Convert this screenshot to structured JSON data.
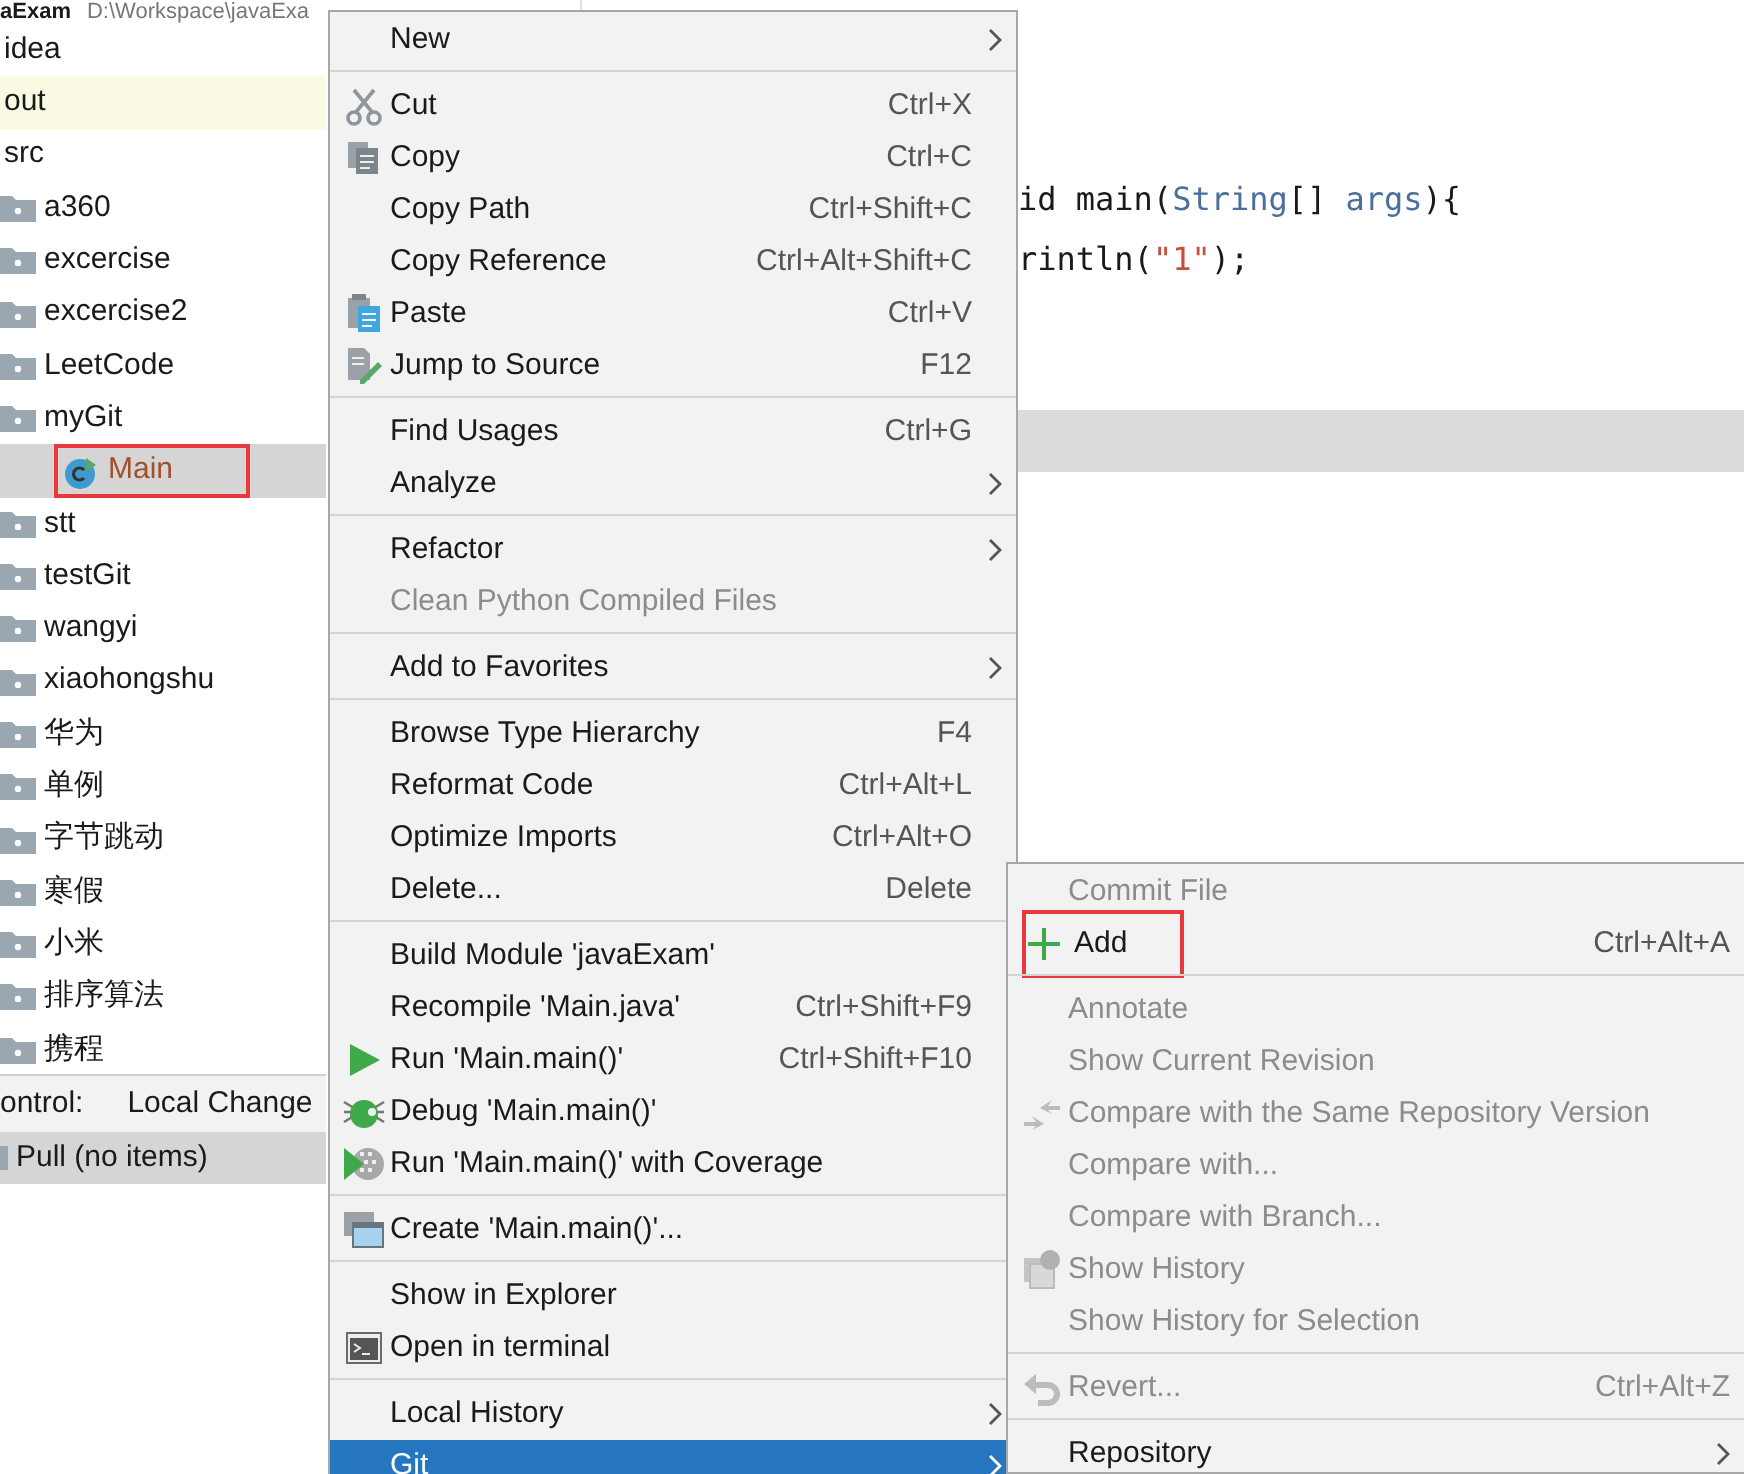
{
  "project_header": {
    "name": "aExam",
    "path": "D:\\Workspace\\javaExa"
  },
  "tree": [
    {
      "label": "idea",
      "excluded": false,
      "selected": false,
      "annotated": false
    },
    {
      "label": "out",
      "excluded": true,
      "selected": false,
      "annotated": false
    },
    {
      "label": "src",
      "excluded": false,
      "selected": false,
      "annotated": false,
      "children": [
        {
          "label": "a360",
          "kind": "package",
          "excluded": false,
          "selected": false,
          "annotated": false
        },
        {
          "label": "excercise",
          "kind": "package",
          "excluded": false,
          "selected": false,
          "annotated": false
        },
        {
          "label": "excercise2",
          "kind": "package",
          "excluded": false,
          "selected": false,
          "annotated": false
        },
        {
          "label": "LeetCode",
          "kind": "package",
          "excluded": false,
          "selected": false,
          "annotated": false
        },
        {
          "label": "myGit",
          "kind": "package",
          "excluded": false,
          "selected": false,
          "annotated": false,
          "children": [
            {
              "label": "Main",
              "kind": "class",
              "excluded": false,
              "selected": true,
              "annotated": true
            }
          ]
        },
        {
          "label": "stt",
          "kind": "package",
          "excluded": false,
          "selected": false,
          "annotated": false
        },
        {
          "label": "testGit",
          "kind": "package",
          "excluded": false,
          "selected": false,
          "annotated": false
        },
        {
          "label": "wangyi",
          "kind": "package",
          "excluded": false,
          "selected": false,
          "annotated": false
        },
        {
          "label": "xiaohongshu",
          "kind": "package",
          "excluded": false,
          "selected": false,
          "annotated": false
        },
        {
          "label": "华为",
          "kind": "package",
          "excluded": false,
          "selected": false,
          "annotated": false
        },
        {
          "label": "单例",
          "kind": "package",
          "excluded": false,
          "selected": false,
          "annotated": false
        },
        {
          "label": "字节跳动",
          "kind": "package",
          "excluded": false,
          "selected": false,
          "annotated": false
        },
        {
          "label": "寒假",
          "kind": "package",
          "excluded": false,
          "selected": false,
          "annotated": false
        },
        {
          "label": "小米",
          "kind": "package",
          "excluded": false,
          "selected": false,
          "annotated": false
        },
        {
          "label": "排序算法",
          "kind": "package",
          "excluded": false,
          "selected": false,
          "annotated": false
        },
        {
          "label": "携程",
          "kind": "package",
          "excluded": false,
          "selected": false,
          "annotated": false
        }
      ]
    }
  ],
  "version_control": {
    "title": "ontrol:",
    "tab": "Local Change",
    "row": "Pull (no items)"
  },
  "editor": {
    "lines": [
      {
        "kind": "top"
      },
      {
        "kind": "blank"
      },
      {
        "kind": "blank"
      },
      {
        "kind": "code",
        "parts": [
          {
            "text": "id main(",
            "kind": "plain"
          },
          {
            "text": "String",
            "kind": "type"
          },
          {
            "text": "[] ",
            "kind": "plain"
          },
          {
            "text": "args",
            "kind": "param"
          },
          {
            "text": "){",
            "kind": "plain"
          }
        ]
      },
      {
        "kind": "code",
        "parts": [
          {
            "text": "rintln(",
            "kind": "plain"
          },
          {
            "text": "\"1\"",
            "kind": "string"
          },
          {
            "text": ");",
            "kind": "plain"
          }
        ]
      },
      {
        "kind": "blank"
      },
      {
        "kind": "blank"
      },
      {
        "kind": "current"
      }
    ]
  },
  "context_menu": [
    {
      "kind": "item",
      "label": "New",
      "submenu": true,
      "disabled": false,
      "selected": false
    },
    {
      "kind": "separator"
    },
    {
      "kind": "item",
      "label": "Cut",
      "shortcut": "Ctrl+X",
      "submenu": false,
      "disabled": false,
      "selected": false
    },
    {
      "kind": "item",
      "label": "Copy",
      "shortcut": "Ctrl+C",
      "submenu": false,
      "disabled": false,
      "selected": false
    },
    {
      "kind": "item",
      "label": "Copy Path",
      "shortcut": "Ctrl+Shift+C",
      "submenu": false,
      "disabled": false,
      "selected": false
    },
    {
      "kind": "item",
      "label": "Copy Reference",
      "shortcut": "Ctrl+Alt+Shift+C",
      "submenu": false,
      "disabled": false,
      "selected": false
    },
    {
      "kind": "item",
      "label": "Paste",
      "shortcut": "Ctrl+V",
      "submenu": false,
      "disabled": false,
      "selected": false
    },
    {
      "kind": "item",
      "label": "Jump to Source",
      "shortcut": "F12",
      "submenu": false,
      "disabled": false,
      "selected": false
    },
    {
      "kind": "separator"
    },
    {
      "kind": "item",
      "label": "Find Usages",
      "shortcut": "Ctrl+G",
      "submenu": false,
      "disabled": false,
      "selected": false
    },
    {
      "kind": "item",
      "label": "Analyze",
      "submenu": true,
      "disabled": false,
      "selected": false
    },
    {
      "kind": "separator"
    },
    {
      "kind": "item",
      "label": "Refactor",
      "submenu": true,
      "disabled": false,
      "selected": false
    },
    {
      "kind": "item",
      "label": "Clean Python Compiled Files",
      "submenu": false,
      "disabled": true,
      "selected": false
    },
    {
      "kind": "separator"
    },
    {
      "kind": "item",
      "label": "Add to Favorites",
      "submenu": true,
      "disabled": false,
      "selected": false
    },
    {
      "kind": "separator"
    },
    {
      "kind": "item",
      "label": "Browse Type Hierarchy",
      "shortcut": "F4",
      "submenu": false,
      "disabled": false,
      "selected": false
    },
    {
      "kind": "item",
      "label": "Reformat Code",
      "shortcut": "Ctrl+Alt+L",
      "submenu": false,
      "disabled": false,
      "selected": false
    },
    {
      "kind": "item",
      "label": "Optimize Imports",
      "shortcut": "Ctrl+Alt+O",
      "submenu": false,
      "disabled": false,
      "selected": false
    },
    {
      "kind": "item",
      "label": "Delete...",
      "shortcut": "Delete",
      "submenu": false,
      "disabled": false,
      "selected": false
    },
    {
      "kind": "separator"
    },
    {
      "kind": "item",
      "label": "Build Module 'javaExam'",
      "submenu": false,
      "disabled": false,
      "selected": false
    },
    {
      "kind": "item",
      "label": "Recompile 'Main.java'",
      "shortcut": "Ctrl+Shift+F9",
      "submenu": false,
      "disabled": false,
      "selected": false
    },
    {
      "kind": "item",
      "label": "Run 'Main.main()'",
      "shortcut": "Ctrl+Shift+F10",
      "submenu": false,
      "disabled": false,
      "selected": false
    },
    {
      "kind": "item",
      "label": "Debug 'Main.main()'",
      "submenu": false,
      "disabled": false,
      "selected": false
    },
    {
      "kind": "item",
      "label": "Run 'Main.main()' with Coverage",
      "submenu": false,
      "disabled": false,
      "selected": false
    },
    {
      "kind": "separator"
    },
    {
      "kind": "item",
      "label": "Create 'Main.main()'...",
      "submenu": false,
      "disabled": false,
      "selected": false
    },
    {
      "kind": "separator"
    },
    {
      "kind": "item",
      "label": "Show in Explorer",
      "submenu": false,
      "disabled": false,
      "selected": false
    },
    {
      "kind": "item",
      "label": "Open in terminal",
      "submenu": false,
      "disabled": false,
      "selected": false
    },
    {
      "kind": "separator"
    },
    {
      "kind": "item",
      "label": "Local History",
      "submenu": true,
      "disabled": false,
      "selected": false
    },
    {
      "kind": "item",
      "label": "Git",
      "submenu": true,
      "disabled": false,
      "selected": true
    }
  ],
  "git_submenu": [
    {
      "kind": "item",
      "label": "Commit File",
      "submenu": false,
      "disabled": true,
      "annotated": false
    },
    {
      "kind": "item",
      "label": "Add",
      "shortcut": "Ctrl+Alt+A",
      "submenu": false,
      "disabled": false,
      "annotated": true
    },
    {
      "kind": "separator"
    },
    {
      "kind": "item",
      "label": "Annotate",
      "submenu": false,
      "disabled": true,
      "annotated": false
    },
    {
      "kind": "item",
      "label": "Show Current Revision",
      "submenu": false,
      "disabled": true,
      "annotated": false
    },
    {
      "kind": "item",
      "label": "Compare with the Same Repository Version",
      "submenu": false,
      "disabled": true,
      "annotated": false
    },
    {
      "kind": "item",
      "label": "Compare with...",
      "submenu": false,
      "disabled": true,
      "annotated": false
    },
    {
      "kind": "item",
      "label": "Compare with Branch...",
      "submenu": false,
      "disabled": true,
      "annotated": false
    },
    {
      "kind": "item",
      "label": "Show History",
      "submenu": false,
      "disabled": true,
      "annotated": false
    },
    {
      "kind": "item",
      "label": "Show History for Selection",
      "submenu": false,
      "disabled": true,
      "annotated": false
    },
    {
      "kind": "separator"
    },
    {
      "kind": "item",
      "label": "Revert...",
      "shortcut": "Ctrl+Alt+Z",
      "submenu": false,
      "disabled": true,
      "annotated": false
    },
    {
      "kind": "separator"
    },
    {
      "kind": "item",
      "label": "Repository",
      "submenu": true,
      "disabled": false,
      "annotated": false
    }
  ]
}
